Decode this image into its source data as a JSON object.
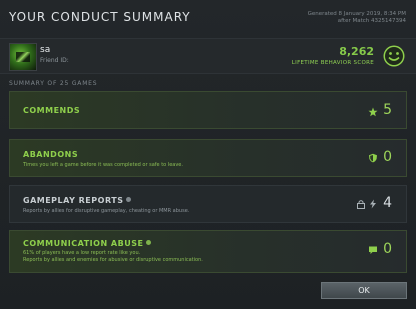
{
  "dialog": {
    "title": "YOUR CONDUCT SUMMARY",
    "generated_line1": "Generated 8 January 2019, 8:34 PM",
    "generated_line2": "after Match 4325147394"
  },
  "player": {
    "name": "sa",
    "friend_id_label": "Friend ID:",
    "score": "8,262",
    "score_label": "LIFETIME BEHAVIOR SCORE",
    "smiley_icon": "smiley-face-icon"
  },
  "summary_label": "SUMMARY OF 25 GAMES",
  "rows": [
    {
      "title": "COMMENDS",
      "description": "",
      "count": "5",
      "icon": "star-icon",
      "style": "green"
    },
    {
      "title": "ABANDONS",
      "description": "Times you left a game before it was completed or safe to leave.",
      "count": "0",
      "icon": "shield-icon",
      "style": "green"
    },
    {
      "title": "GAMEPLAY REPORTS",
      "description": "Reports by allies for disruptive gameplay, cheating or MMR abuse.",
      "count": "4",
      "icon": "lock-lightning-icon",
      "style": "gray"
    },
    {
      "title": "COMMUNICATION ABUSE",
      "description_line1": "61% of players have a low report rate like you.",
      "description_line2": "Reports by allies and enemies for abusive or disruptive communication.",
      "count": "0",
      "icon": "chat-bubble-icon",
      "style": "green"
    }
  ],
  "ok_button": "OK",
  "colors": {
    "accent_green": "#8fd04c",
    "background": "#1b1e21"
  }
}
